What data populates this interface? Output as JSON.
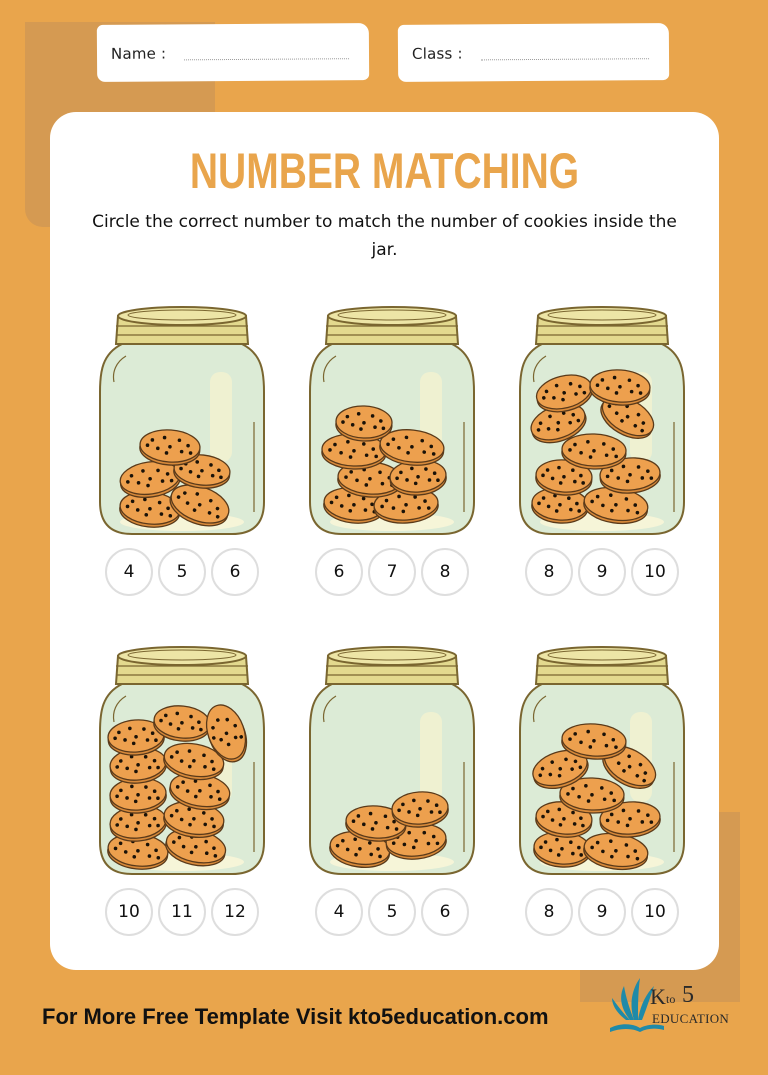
{
  "header": {
    "name_label": "Name :",
    "class_label": "Class :"
  },
  "worksheet": {
    "title": "NUMBER MATCHING",
    "instructions": "Circle the correct number to match the number of cookies inside the jar."
  },
  "jars": [
    {
      "cookie_count": 5,
      "choices": [
        "4",
        "5",
        "6"
      ]
    },
    {
      "cookie_count": 7,
      "choices": [
        "6",
        "7",
        "8"
      ]
    },
    {
      "cookie_count": 9,
      "choices": [
        "8",
        "9",
        "10"
      ]
    },
    {
      "cookie_count": 11,
      "choices": [
        "10",
        "11",
        "12"
      ]
    },
    {
      "cookie_count": 4,
      "choices": [
        "4",
        "5",
        "6"
      ]
    },
    {
      "cookie_count": 8,
      "choices": [
        "8",
        "9",
        "10"
      ]
    }
  ],
  "footer": {
    "promo_text": "For More Free Template Visit kto5education.com",
    "logo": {
      "k": "K",
      "to": "to",
      "five": "5",
      "education": "EDUCATION"
    }
  },
  "colors": {
    "background": "#e9a54c",
    "accent_shape": "#d59a52",
    "title": "#e9a54c",
    "cookie": "#eda04e",
    "cookie_outline": "#5a3a1a",
    "jar_glass": "#dcebd6",
    "jar_outline": "#7a6630",
    "jar_lid": "#e3d98e",
    "logo_teal": "#1f8aa8"
  },
  "icons": {
    "jar": "mason-jar-icon",
    "cookie": "chocolate-chip-cookie-icon",
    "logo": "book-leaves-logo-icon"
  }
}
